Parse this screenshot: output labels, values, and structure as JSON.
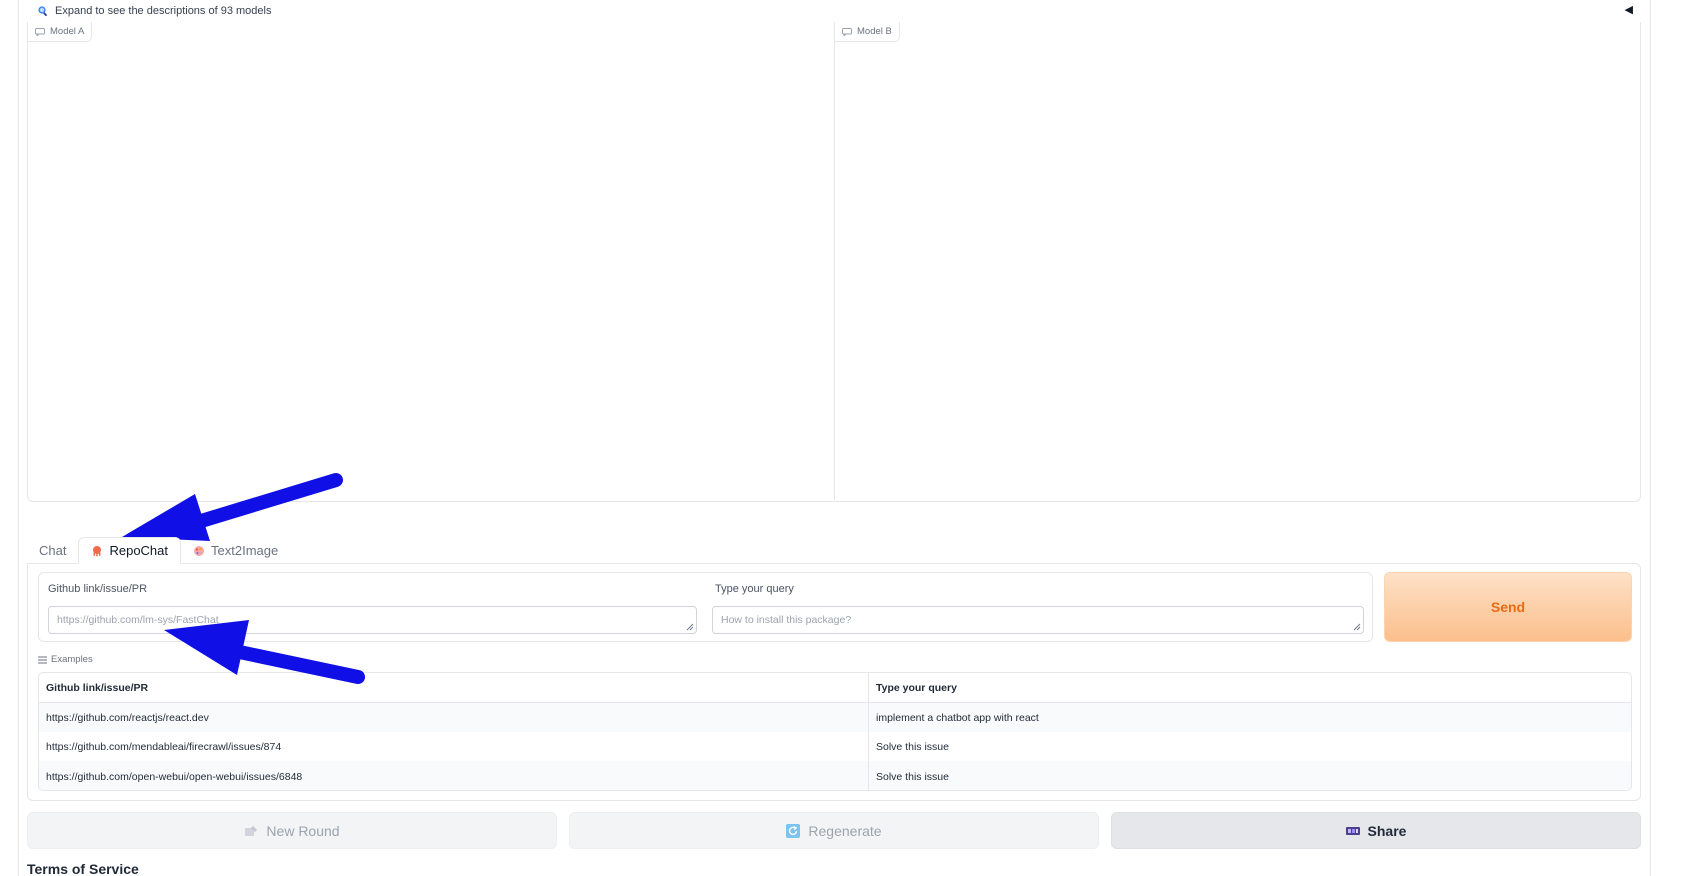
{
  "accordion": {
    "label": "Expand to see the descriptions of 93 models",
    "caret": "◀"
  },
  "panels": {
    "a_label": "Model A",
    "b_label": "Model B"
  },
  "tabs": [
    {
      "label": "Chat"
    },
    {
      "label": "RepoChat",
      "active": true
    },
    {
      "label": "Text2Image"
    }
  ],
  "repochat": {
    "github_label": "Github link/issue/PR",
    "github_placeholder": "https://github.com/lm-sys/FastChat",
    "query_label": "Type your query",
    "query_placeholder": "How to install this package?",
    "send_label": "Send"
  },
  "examples": {
    "label": "Examples",
    "headers": [
      "Github link/issue/PR",
      "Type your query"
    ],
    "rows": [
      [
        "https://github.com/reactjs/react.dev",
        "implement a chatbot app with react"
      ],
      [
        "https://github.com/mendableai/firecrawl/issues/874",
        "Solve this issue"
      ],
      [
        "https://github.com/open-webui/open-webui/issues/6848",
        "Solve this issue"
      ]
    ]
  },
  "actions": {
    "new_round": "New Round",
    "regenerate": "Regenerate",
    "share": "Share"
  },
  "footer": {
    "terms": "Terms of Service"
  },
  "colors": {
    "send_text": "#ea6b14",
    "send_bg_top": "#fde1c7",
    "send_bg_bottom": "#fbbf8c",
    "annotation_arrow": "#1010e6"
  }
}
